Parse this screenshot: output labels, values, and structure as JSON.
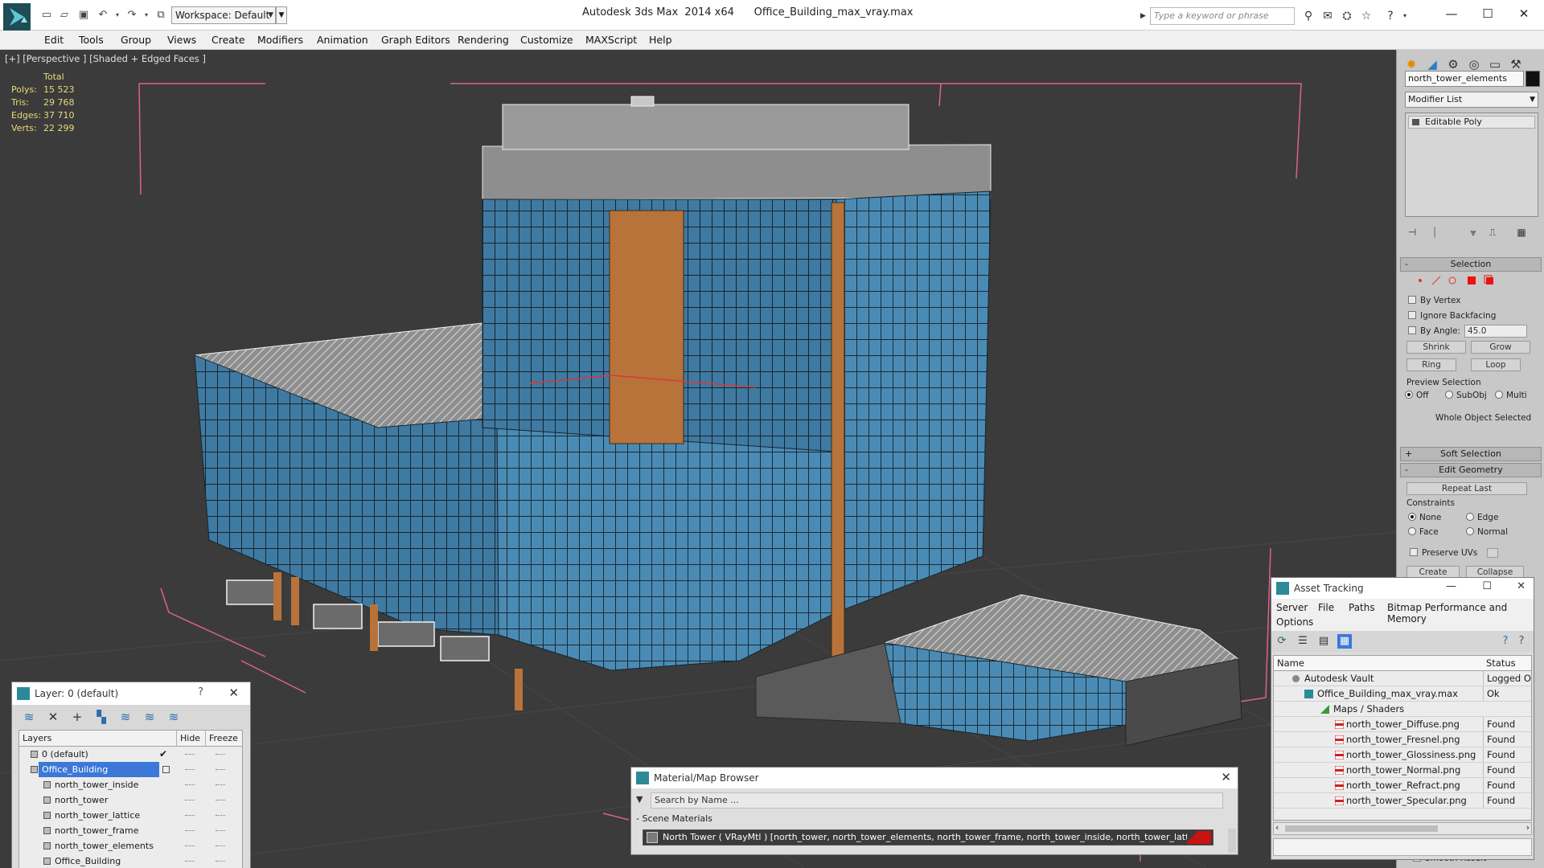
{
  "titlebar": {
    "workspace": "Workspace: Default",
    "title": "Autodesk 3ds Max  2014 x64      Office_Building_max_vray.max",
    "search_placeholder": "Type a keyword or phrase"
  },
  "menu": [
    "Edit",
    "Tools",
    "Group",
    "Views",
    "Create",
    "Modifiers",
    "Animation",
    "Graph Editors",
    "Rendering",
    "Customize",
    "MAXScript",
    "Help"
  ],
  "viewport": {
    "label": "[+] [Perspective ] [Shaded + Edged Faces ]",
    "stats": {
      "total_label": "Total",
      "rows": [
        {
          "k": "Polys:",
          "v": "15 523"
        },
        {
          "k": "Tris:",
          "v": "29 768"
        },
        {
          "k": "Edges:",
          "v": "37 710"
        },
        {
          "k": "Verts:",
          "v": "22 299"
        }
      ]
    },
    "colors": {
      "background": "#3b3b3b",
      "glass": "#4a8bb5",
      "accent_panel": "#b8733a",
      "bracket": "#e06090"
    }
  },
  "command_panel": {
    "object_name": "north_tower_elements",
    "modifier_list": "Modifier List",
    "stack_item": "Editable Poly",
    "selection": {
      "title": "Selection",
      "by_vertex": "By Vertex",
      "ignore_backfacing": "Ignore Backfacing",
      "by_angle": "By Angle:",
      "angle_value": "45.0",
      "shrink": "Shrink",
      "grow": "Grow",
      "ring": "Ring",
      "loop": "Loop",
      "preview_selection": "Preview Selection",
      "off": "Off",
      "subobj": "SubObj",
      "multi": "Multi",
      "status": "Whole Object Selected"
    },
    "soft_selection": "Soft Selection",
    "edit_geometry": {
      "title": "Edit Geometry",
      "repeat_last": "Repeat Last",
      "constraints": "Constraints",
      "none": "None",
      "edge": "Edge",
      "face": "Face",
      "normal": "Normal",
      "preserve_uvs": "Preserve UVs",
      "create": "Create",
      "collapse": "Collapse"
    },
    "smooth_result": "Smooth Result"
  },
  "layer_window": {
    "title": "Layer: 0 (default)",
    "help": "?",
    "columns": [
      "Layers",
      "Hide",
      "Freeze"
    ],
    "rows": [
      {
        "name": "0 (default)",
        "level": 0,
        "checked": true
      },
      {
        "name": "Office_Building",
        "level": 0,
        "selected": true
      },
      {
        "name": "north_tower_inside",
        "level": 1
      },
      {
        "name": "north_tower",
        "level": 1
      },
      {
        "name": "north_tower_lattice",
        "level": 1
      },
      {
        "name": "north_tower_frame",
        "level": 1
      },
      {
        "name": "north_tower_elements",
        "level": 1
      },
      {
        "name": "Office_Building",
        "level": 1
      }
    ]
  },
  "material_browser": {
    "title": "Material/Map Browser",
    "search_placeholder": "Search by Name ...",
    "section": "- Scene Materials",
    "material": "North Tower  ( VRayMtl ) [north_tower, north_tower_elements, north_tower_frame, north_tower_inside, north_tower_lattice]"
  },
  "asset_tracking": {
    "title": "Asset Tracking",
    "menu": [
      "Server",
      "File",
      "Paths",
      "Bitmap Performance and Memory",
      "Options"
    ],
    "columns": [
      "Name",
      "Status"
    ],
    "rows": [
      {
        "name": "Autodesk Vault",
        "status": "Logged Out",
        "level": 0,
        "icon": "vault-icon"
      },
      {
        "name": "Office_Building_max_vray.max",
        "status": "Ok",
        "level": 1,
        "icon": "max-file-icon"
      },
      {
        "name": "Maps / Shaders",
        "status": "",
        "level": 2,
        "icon": "maps-icon"
      },
      {
        "name": "north_tower_Diffuse.png",
        "status": "Found",
        "level": 3,
        "icon": "png-icon"
      },
      {
        "name": "north_tower_Fresnel.png",
        "status": "Found",
        "level": 3,
        "icon": "png-icon"
      },
      {
        "name": "north_tower_Glossiness.png",
        "status": "Found",
        "level": 3,
        "icon": "png-icon"
      },
      {
        "name": "north_tower_Normal.png",
        "status": "Found",
        "level": 3,
        "icon": "png-icon"
      },
      {
        "name": "north_tower_Refract.png",
        "status": "Found",
        "level": 3,
        "icon": "png-icon"
      },
      {
        "name": "north_tower_Specular.png",
        "status": "Found",
        "level": 3,
        "icon": "png-icon"
      }
    ]
  }
}
